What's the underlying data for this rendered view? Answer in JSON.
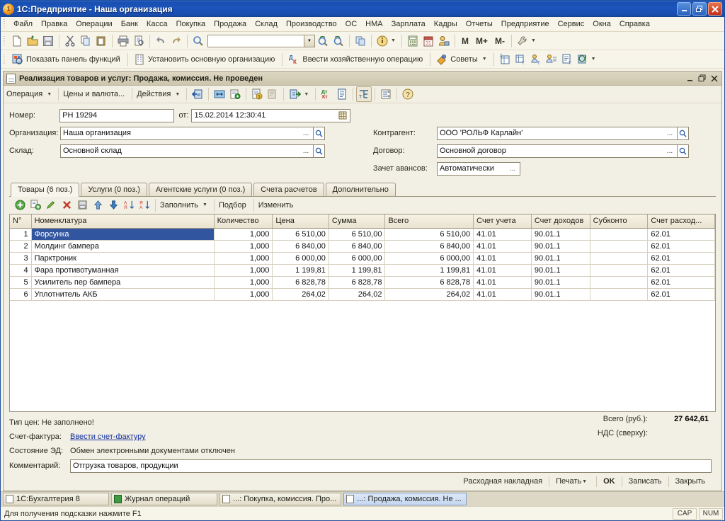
{
  "window": {
    "title": "1С:Предприятие  - Наша организация",
    "app_icon": "1c-logo-icon",
    "buttons": {
      "minimize": "_",
      "restore": "❐",
      "close": "✕"
    }
  },
  "menubar": {
    "items": [
      "Файл",
      "Правка",
      "Операции",
      "Банк",
      "Касса",
      "Покупка",
      "Продажа",
      "Склад",
      "Производство",
      "ОС",
      "НМА",
      "Зарплата",
      "Кадры",
      "Отчеты",
      "Предприятие",
      "Сервис",
      "Окна",
      "Справка"
    ]
  },
  "toolbar_main": {
    "search_value": "",
    "search_placeholder": "",
    "memory_buttons": [
      "M",
      "M+",
      "M-"
    ]
  },
  "toolbar_secondary": {
    "show_functions_panel": "Показать панель функций",
    "set_main_org": "Установить основную организацию",
    "enter_operation": "Ввести хозяйственную операцию",
    "tips": "Советы"
  },
  "document": {
    "title": "Реализация товаров и услуг: Продажа, комиссия. Не проведен",
    "title_icon": "document-icon",
    "win_buttons": {
      "minimize": "_",
      "restore": "❐",
      "close": "✕"
    },
    "toolbar": {
      "operation": "Операция",
      "prices_currency": "Цены и валюта...",
      "actions": "Действия"
    },
    "header_fields": {
      "number_label": "Номер:",
      "number_value": "РН 19294",
      "date_label": "от:",
      "date_value": "15.02.2014 12:30:41",
      "organization_label": "Организация:",
      "organization_value": "Наша организация",
      "warehouse_label": "Склад:",
      "warehouse_value": "Основной склад",
      "counterparty_label": "Контрагент:",
      "counterparty_value": "ООО 'РОЛЬФ Карлайн'",
      "contract_label": "Договор:",
      "contract_value": "Основной договор",
      "advance_offset_label": "Зачет авансов:",
      "advance_offset_value": "Автоматически"
    },
    "tabs": [
      {
        "label": "Товары (6 поз.)",
        "active": true
      },
      {
        "label": "Услуги (0 поз.)",
        "active": false
      },
      {
        "label": "Агентские услуги (0 поз.)",
        "active": false
      },
      {
        "label": "Счета расчетов",
        "active": false
      },
      {
        "label": "Дополнительно",
        "active": false
      }
    ],
    "grid_toolbar": {
      "fill": "Заполнить",
      "selection": "Подбор",
      "change": "Изменить"
    },
    "table": {
      "columns": [
        "N°",
        "Номенклатура",
        "Количество",
        "Цена",
        "Сумма",
        "Всего",
        "Счет учета",
        "Счет доходов",
        "Субконто",
        "Счет расход..."
      ],
      "rows": [
        {
          "n": "1",
          "item": "Форсунка",
          "qty": "1,000",
          "price": "6 510,00",
          "sum": "6 510,00",
          "total": "6 510,00",
          "acc": "41.01",
          "income_acc": "90.01.1",
          "subconto": "",
          "expense_acc": "62.01",
          "selected": true
        },
        {
          "n": "2",
          "item": "Молдинг бампера",
          "qty": "1,000",
          "price": "6 840,00",
          "sum": "6 840,00",
          "total": "6 840,00",
          "acc": "41.01",
          "income_acc": "90.01.1",
          "subconto": "",
          "expense_acc": "62.01",
          "selected": false
        },
        {
          "n": "3",
          "item": "Парктроник",
          "qty": "1,000",
          "price": "6 000,00",
          "sum": "6 000,00",
          "total": "6 000,00",
          "acc": "41.01",
          "income_acc": "90.01.1",
          "subconto": "",
          "expense_acc": "62.01",
          "selected": false
        },
        {
          "n": "4",
          "item": "Фара противотуманная",
          "qty": "1,000",
          "price": "1 199,81",
          "sum": "1 199,81",
          "total": "1 199,81",
          "acc": "41.01",
          "income_acc": "90.01.1",
          "subconto": "",
          "expense_acc": "62.01",
          "selected": false
        },
        {
          "n": "5",
          "item": "Усилитель пер бампера",
          "qty": "1,000",
          "price": "6 828,78",
          "sum": "6 828,78",
          "total": "6 828,78",
          "acc": "41.01",
          "income_acc": "90.01.1",
          "subconto": "",
          "expense_acc": "62.01",
          "selected": false
        },
        {
          "n": "6",
          "item": "Уплотнитель АКБ",
          "qty": "1,000",
          "price": "264,02",
          "sum": "264,02",
          "total": "264,02",
          "acc": "41.01",
          "income_acc": "90.01.1",
          "subconto": "",
          "expense_acc": "62.01",
          "selected": false
        }
      ]
    },
    "footer": {
      "price_type": "Тип цен: Не заполнено!",
      "invoice_label": "Счет-фактура:",
      "invoice_link": "Ввести счет-фактуру",
      "ed_state_label": "Состояние ЭД:",
      "ed_state_value": "Обмен электронными документами отключен",
      "comment_label": "Комментарий:",
      "comment_value": "Отгрузка товаров, продукции",
      "total_label": "Всего (руб.):",
      "total_value": "27 642,61",
      "vat_label": "НДС (сверху):",
      "vat_value": ""
    },
    "commands": {
      "waybill": "Расходная накладная",
      "print": "Печать",
      "ok": "OK",
      "save": "Записать",
      "close": "Закрыть"
    }
  },
  "taskbar": {
    "items": [
      {
        "label": "1С:Бухгалтерия 8",
        "active": false,
        "icon": "doc-icon"
      },
      {
        "label": "Журнал операций",
        "active": false,
        "icon": "journal-icon"
      },
      {
        "label": "...: Покупка, комиссия. Про...",
        "active": false,
        "icon": "doc-icon"
      },
      {
        "label": "...: Продажа, комиссия. Не ...",
        "active": true,
        "icon": "doc-icon"
      }
    ]
  },
  "statusbar": {
    "hint": "Для получения подсказки нажмите F1",
    "caps": "CAP",
    "num": "NUM"
  },
  "colors": {
    "title_bar": "#1b54bb",
    "app_background": "#f7f4e9",
    "panel": "#f2efe4",
    "selection": "#31559e",
    "link": "#15329e",
    "border": "#9d9682"
  }
}
